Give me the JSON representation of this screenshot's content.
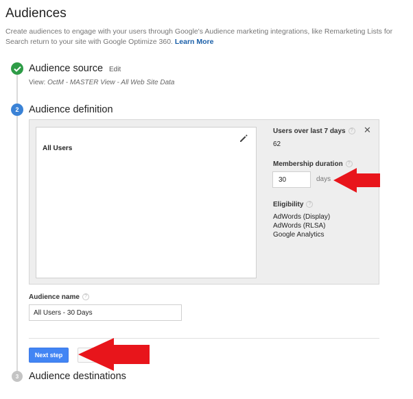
{
  "page": {
    "title": "Audiences",
    "intro_text": "Create audiences to engage with your users through Google's Audience marketing integrations, like Remarketing Lists for Search return to your site with Google Optimize 360.",
    "intro_link": "Learn More"
  },
  "steps": {
    "source": {
      "title": "Audience source",
      "edit_label": "Edit",
      "view_prefix": "View:",
      "view_value": "OctM - MASTER View - All Web Site Data"
    },
    "definition": {
      "number": "2",
      "title": "Audience definition"
    },
    "destinations": {
      "number": "3",
      "title": "Audience destinations"
    }
  },
  "definition_panel": {
    "segment_label": "All Users",
    "users_label": "Users over last 7 days",
    "users_value": "62",
    "membership_label": "Membership duration",
    "membership_value": "30",
    "membership_unit": "days",
    "eligibility_label": "Eligibility",
    "eligibility_items": [
      "AdWords (Display)",
      "AdWords (RLSA)",
      "Google Analytics"
    ],
    "help_glyph": "?",
    "close_glyph": "✕"
  },
  "audience_name": {
    "label": "Audience name",
    "value": "All Users - 30 Days"
  },
  "actions": {
    "next_label": "Next step"
  },
  "icons": [
    "check-icon",
    "pencil-icon",
    "close-icon",
    "help-icon",
    "red-arrow-icon"
  ],
  "colors": {
    "done_green": "#2e9c47",
    "active_blue": "#3a82d6",
    "button_blue": "#4285f4",
    "link_blue": "#1a5fa8",
    "arrow_red": "#e8151b"
  }
}
